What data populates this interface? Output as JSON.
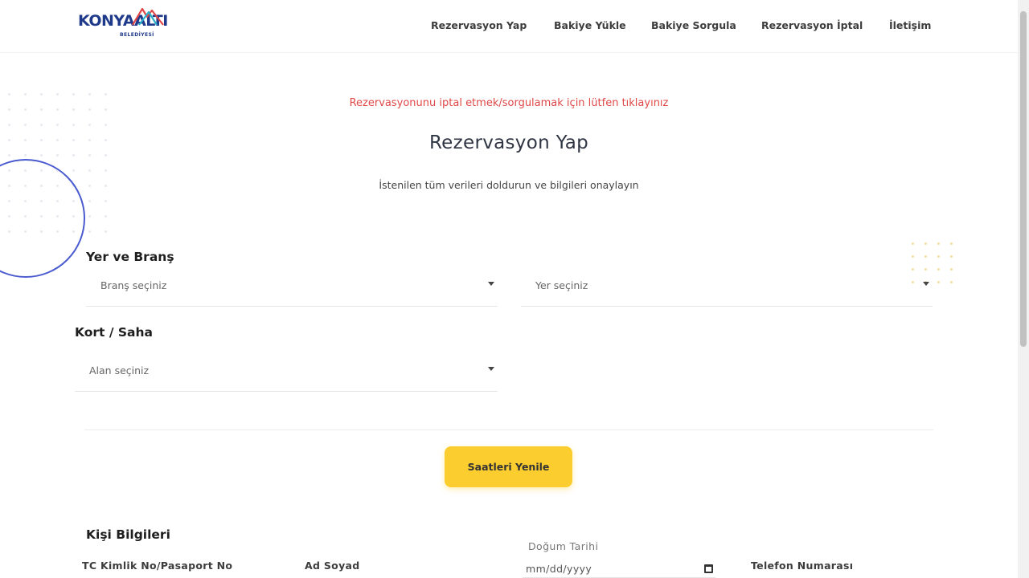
{
  "header": {
    "logo_text": "KONYAALTI",
    "logo_sub": "BELEDİYESİ",
    "nav": [
      {
        "label": "Rezervasyon Yap"
      },
      {
        "label": "Bakiye Yükle"
      },
      {
        "label": "Bakiye Sorgula"
      },
      {
        "label": "Rezervasyon İptal"
      },
      {
        "label": "İletişim"
      }
    ]
  },
  "main": {
    "notice": "Rezervasyonunu iptal etmek/sorgulamak için lütfen tıklayınız",
    "title": "Rezervasyon Yap",
    "subtitle": "İstenilen tüm verileri doldurun ve bilgileri onaylayın"
  },
  "location": {
    "title": "Yer ve Branş",
    "branch_placeholder": "Branş seçiniz",
    "place_placeholder": "Yer seçiniz"
  },
  "court": {
    "title": "Kort / Saha",
    "area_placeholder": "Alan seçiniz"
  },
  "refresh_button": "Saatleri Yenile",
  "person": {
    "title": "Kişi Bilgileri",
    "tc_label": "TC Kimlik No/Pasaport No",
    "name_label": "Ad Soyad",
    "birth_label": "Doğum Tarihi",
    "birth_placeholder": "mm/dd/yyyy",
    "phone_label": "Telefon Numarası"
  },
  "colors": {
    "accent": "#fccd2e",
    "notice": "#e04848",
    "brand": "#1f3a8a"
  }
}
